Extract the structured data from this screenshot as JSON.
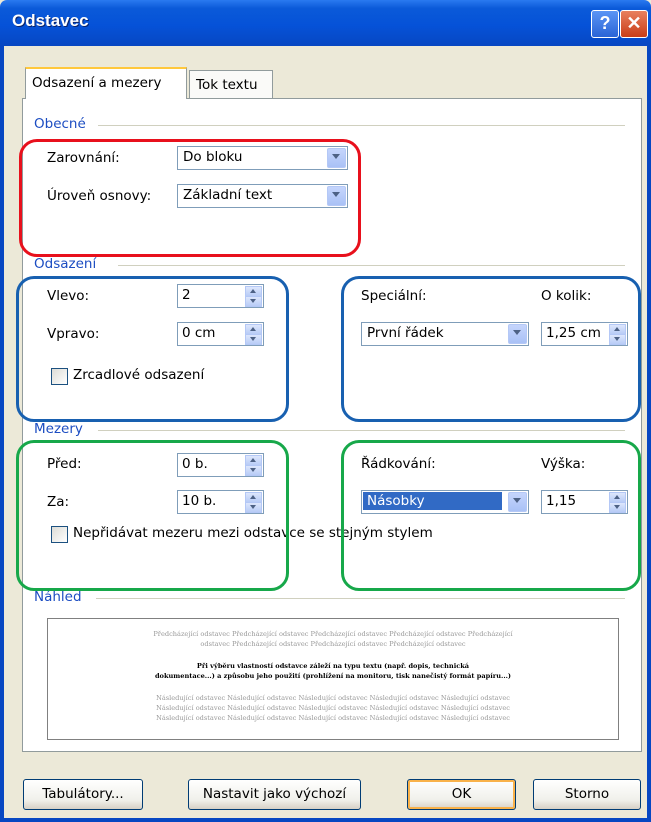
{
  "window": {
    "title": "Odstavec"
  },
  "titlebar": {
    "help_label": "?",
    "close_label": "✕"
  },
  "tabs": [
    {
      "label": "Odsazení a mezery"
    },
    {
      "label": "Tok textu"
    }
  ],
  "sections": {
    "general": "Obecné",
    "indent": "Odsazení",
    "spacing": "Mezery",
    "preview": "Náhled"
  },
  "general": {
    "alignment_label": "Zarovnání:",
    "alignment_value": "Do bloku",
    "outline_label": "Úroveň osnovy:",
    "outline_value": "Základní text"
  },
  "indent": {
    "left_label": "Vlevo:",
    "left_value": "2",
    "right_label": "Vpravo:",
    "right_value": "0 cm",
    "mirror_label": "Zrcadlové odsazení",
    "special_label": "Speciální:",
    "special_value": "První řádek",
    "by_label": "O kolik:",
    "by_value": "1,25 cm"
  },
  "spacing": {
    "before_label": "Před:",
    "before_value": "0 b.",
    "after_label": "Za:",
    "after_value": "10 b.",
    "no_space_label": "Nepřidávat mezeru mezi odstavce se stejným stylem",
    "line_label": "Řádkování:",
    "line_value": "Násobky",
    "at_label": "Výška:",
    "at_value": "1,15"
  },
  "preview": {
    "prev1": "Předcházející odstavec Předcházející odstavec Předcházející odstavec Předcházející odstavec Předcházející",
    "prev2": "odstavec Předcházející odstavec Předcházející odstavec Předcházející odstavec",
    "cur1": "Při výběru vlastností odstavce záleží na typu textu (např. dopis, technická",
    "cur2": "dokumentace...) a způsobu jeho použití (prohlížení na monitoru, tisk nanečistý formát papíru...)",
    "next1": "Následující odstavec Následující odstavec Následující odstavec Následující odstavec Následující odstavec",
    "next2": "Následující odstavec Následující odstavec Následující odstavec Následující odstavec Následující odstavec",
    "next3": "Následující odstavec Následující odstavec Následující odstavec Následující odstavec Následující odstavec"
  },
  "buttons": {
    "tabs": "Tabulátory...",
    "default": "Nastavit jako výchozí",
    "ok": "OK",
    "cancel": "Storno"
  },
  "colors": {
    "red_ring": "#e8101c",
    "blue_ring": "#1860b0",
    "green_ring": "#17a84a"
  }
}
